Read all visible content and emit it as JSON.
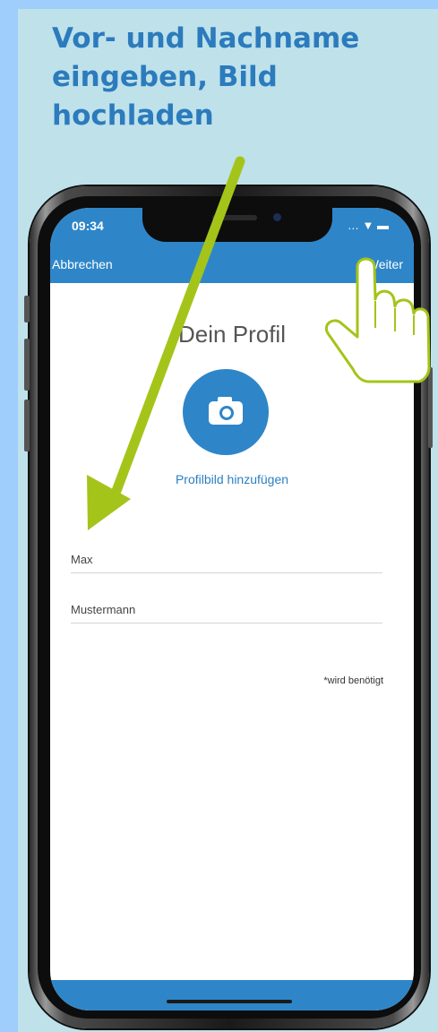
{
  "heading": {
    "lines": [
      "Vor- und Nachname",
      "eingeben, Bild",
      "hochladen"
    ]
  },
  "status_bar": {
    "time": "09:34",
    "icons": "… ▼ ▬"
  },
  "navbar": {
    "left_label": "Abbrechen",
    "right_label": "Weiter"
  },
  "screen": {
    "title": "Dein Profil",
    "add_photo_label": "Profilbild hinzufügen",
    "first_name_value": "Max",
    "last_name_value": "Mustermann",
    "required_note": "*wird benötigt"
  },
  "icons": {
    "avatar": "camera-icon",
    "arrow": "arrow-icon",
    "hand": "pointing-hand-icon"
  },
  "colors": {
    "accent": "#2e86c9",
    "heading": "#2b7bbd",
    "arrow": "#a4c41a",
    "background": "#bfe1ea"
  }
}
